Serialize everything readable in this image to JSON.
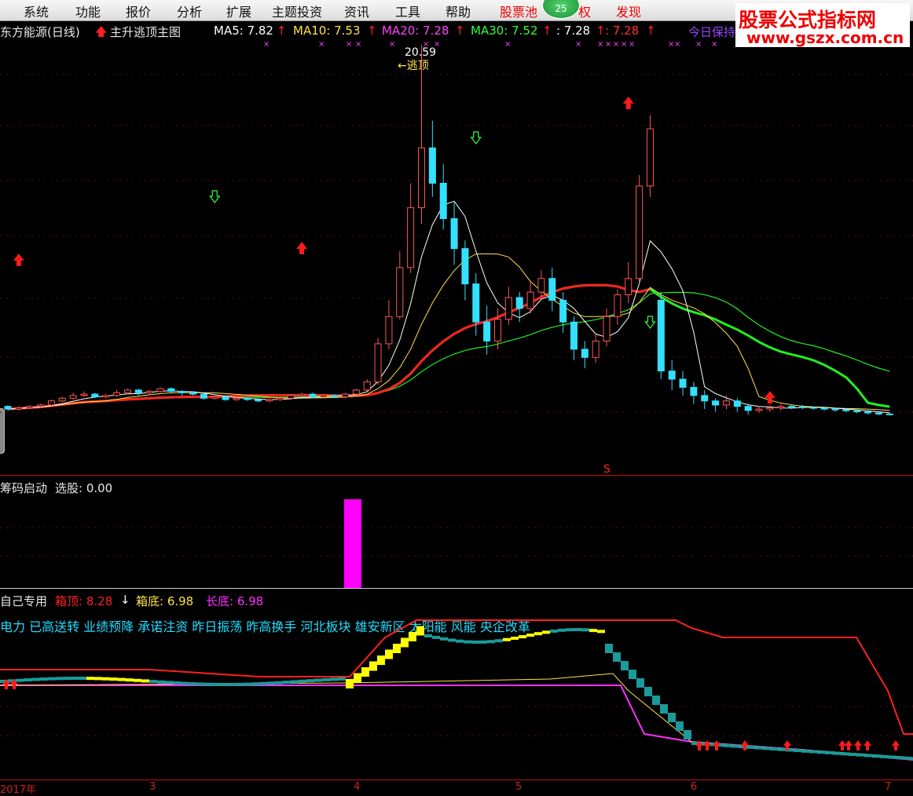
{
  "menu": {
    "items": [
      "系统",
      "功能",
      "报价",
      "分析",
      "扩展",
      "主题投资",
      "资讯",
      "工具",
      "帮助"
    ],
    "stock_pool": "股票池",
    "badge": "25",
    "partial": "权",
    "discover": "发现"
  },
  "watermark": {
    "line1": "股票公式指标网",
    "line2": "www.gszx.com.cn"
  },
  "main_panel": {
    "stock_title": "东方能源(日线)",
    "indicator_name": "主升逃顶主图",
    "ma": [
      {
        "label": "MA5: 7.82",
        "color": "#ffffff"
      },
      {
        "label": "MA10: 7.53",
        "color": "#ffe24a"
      },
      {
        "label": "MA20: 7.28",
        "color": "#ff40ff"
      },
      {
        "label": "MA30: 7.52",
        "color": "#33ff33"
      },
      {
        "label": ": 7.28",
        "color": "#ffffff"
      },
      {
        "label": ": 7.28",
        "color": "#ff3333"
      }
    ],
    "right_label": "今日保持",
    "high_price": "20.59",
    "escape_label": "←逃顶",
    "s_mark": "S"
  },
  "sub_panel1": {
    "name": "筹码启动",
    "label": "选股: 0.00"
  },
  "sub_panel2": {
    "name": "自己专用",
    "box_top": "箱顶: 8.28",
    "box_bottom": "箱底: 6.98",
    "long_bottom": "长底: 6.98",
    "concepts": "电力 已高送转 业绩预降 承诺注资 昨日振荡 昨高换手 河北板块 雄安新区 太阳能 风能 央企改革"
  },
  "x_axis": {
    "labels": [
      "2017年",
      "3",
      "4",
      "5",
      "6",
      "7"
    ]
  },
  "colors": {
    "up": "#ff5555",
    "down": "#33e0ff",
    "ma5": "#ffffff",
    "ma10": "#ffe24a",
    "ma20": "#ff2020",
    "ma30": "#22ee22",
    "box_top": "#ff2020",
    "long_bottom": "#ff30ff",
    "volume": "#ff00ff",
    "teal": "#1a9a9a",
    "yellow": "#ffff00"
  },
  "chart_data": {
    "type": "candlestick",
    "title": "东方能源(日线)",
    "candles": [
      [
        7.3,
        7.2,
        7.35,
        7.15
      ],
      [
        7.2,
        7.25,
        7.3,
        7.15
      ],
      [
        7.25,
        7.3,
        7.35,
        7.2
      ],
      [
        7.3,
        7.35,
        7.4,
        7.25
      ],
      [
        7.35,
        7.5,
        7.55,
        7.3
      ],
      [
        7.5,
        7.6,
        7.65,
        7.45
      ],
      [
        7.6,
        7.7,
        7.8,
        7.55
      ],
      [
        7.7,
        7.75,
        7.85,
        7.65
      ],
      [
        7.75,
        7.65,
        7.8,
        7.6
      ],
      [
        7.65,
        7.7,
        7.75,
        7.6
      ],
      [
        7.7,
        7.8,
        7.9,
        7.65
      ],
      [
        7.8,
        7.9,
        7.95,
        7.75
      ],
      [
        7.9,
        7.8,
        7.95,
        7.7
      ],
      [
        7.8,
        7.85,
        7.9,
        7.75
      ],
      [
        7.85,
        7.95,
        8.0,
        7.8
      ],
      [
        7.95,
        7.85,
        8.0,
        7.8
      ],
      [
        7.85,
        7.8,
        7.9,
        7.7
      ],
      [
        7.8,
        7.75,
        7.85,
        7.7
      ],
      [
        7.75,
        7.6,
        7.8,
        7.55
      ],
      [
        7.6,
        7.65,
        7.7,
        7.55
      ],
      [
        7.65,
        7.55,
        7.7,
        7.5
      ],
      [
        7.55,
        7.6,
        7.65,
        7.5
      ],
      [
        7.6,
        7.55,
        7.65,
        7.5
      ],
      [
        7.55,
        7.5,
        7.6,
        7.45
      ],
      [
        7.5,
        7.55,
        7.6,
        7.45
      ],
      [
        7.55,
        7.6,
        7.65,
        7.5
      ],
      [
        7.6,
        7.7,
        7.75,
        7.55
      ],
      [
        7.7,
        7.75,
        7.8,
        7.65
      ],
      [
        7.75,
        7.65,
        7.8,
        7.6
      ],
      [
        7.65,
        7.7,
        7.75,
        7.6
      ],
      [
        7.7,
        7.65,
        7.75,
        7.6
      ],
      [
        7.65,
        7.75,
        7.8,
        7.6
      ],
      [
        7.75,
        7.9,
        7.95,
        7.7
      ],
      [
        7.9,
        8.2,
        8.3,
        7.85
      ],
      [
        8.2,
        9.6,
        9.8,
        8.1
      ],
      [
        9.6,
        10.6,
        11.2,
        9.4
      ],
      [
        10.6,
        12.4,
        13.0,
        10.5
      ],
      [
        12.4,
        14.6,
        15.5,
        12.2
      ],
      [
        14.6,
        16.8,
        20.59,
        14.0
      ],
      [
        16.8,
        15.5,
        17.8,
        15.0
      ],
      [
        15.5,
        14.2,
        16.2,
        13.8
      ],
      [
        14.2,
        13.1,
        14.8,
        12.5
      ],
      [
        13.1,
        11.8,
        13.4,
        11.2
      ],
      [
        11.8,
        10.4,
        12.2,
        9.9
      ],
      [
        10.4,
        9.7,
        11.0,
        9.2
      ],
      [
        9.7,
        10.5,
        10.9,
        9.4
      ],
      [
        10.5,
        11.3,
        11.7,
        10.3
      ],
      [
        11.3,
        10.9,
        11.5,
        10.4
      ],
      [
        10.9,
        11.5,
        11.9,
        10.7
      ],
      [
        11.5,
        12.0,
        12.3,
        11.2
      ],
      [
        12.0,
        11.2,
        12.4,
        10.8
      ],
      [
        11.2,
        10.4,
        11.5,
        10.0
      ],
      [
        10.4,
        9.4,
        10.6,
        9.0
      ],
      [
        9.4,
        9.1,
        9.7,
        8.7
      ],
      [
        9.1,
        9.7,
        10.0,
        8.9
      ],
      [
        9.7,
        10.6,
        10.9,
        9.5
      ],
      [
        10.6,
        11.4,
        11.6,
        10.3
      ],
      [
        11.4,
        12.0,
        12.6,
        11.1
      ],
      [
        12.0,
        15.4,
        15.8,
        11.9
      ],
      [
        15.4,
        17.5,
        18.0,
        15.0
      ],
      [
        11.2,
        8.6,
        11.5,
        8.3
      ],
      [
        8.6,
        8.3,
        9.0,
        7.9
      ],
      [
        8.3,
        8.0,
        8.6,
        7.7
      ],
      [
        8.0,
        7.7,
        8.2,
        7.4
      ],
      [
        7.7,
        7.5,
        7.9,
        7.2
      ],
      [
        7.5,
        7.35,
        7.6,
        7.1
      ],
      [
        7.35,
        7.5,
        7.7,
        7.2
      ],
      [
        7.5,
        7.3,
        7.6,
        7.1
      ],
      [
        7.3,
        7.15,
        7.4,
        7.0
      ],
      [
        7.15,
        7.2,
        7.3,
        7.05
      ],
      [
        7.2,
        7.25,
        7.35,
        7.1
      ],
      [
        7.25,
        7.3,
        7.4,
        7.15
      ],
      [
        7.3,
        7.28,
        7.36,
        7.2
      ],
      [
        7.28,
        7.26,
        7.35,
        7.2
      ],
      [
        7.26,
        7.24,
        7.3,
        7.18
      ],
      [
        7.24,
        7.2,
        7.28,
        7.15
      ],
      [
        7.2,
        7.18,
        7.25,
        7.1
      ],
      [
        7.18,
        7.14,
        7.22,
        7.08
      ],
      [
        7.14,
        7.1,
        7.18,
        7.05
      ],
      [
        7.1,
        7.06,
        7.14,
        7.0
      ],
      [
        7.06,
        7.02,
        7.1,
        6.98
      ],
      [
        7.02,
        7.0,
        7.06,
        6.98
      ]
    ]
  }
}
